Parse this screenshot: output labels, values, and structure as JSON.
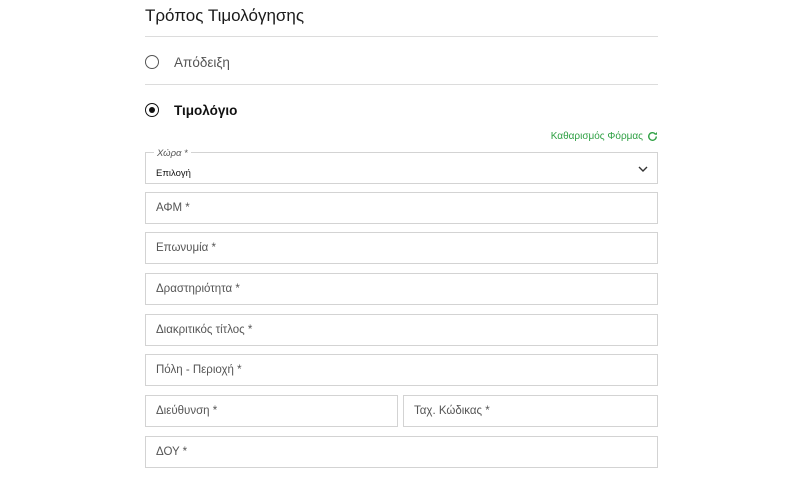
{
  "section": {
    "title": "Τρόπος Τιμολόγησης"
  },
  "billing_options": [
    {
      "label": "Απόδειξη",
      "selected": false
    },
    {
      "label": "Τιμολόγιο",
      "selected": true
    }
  ],
  "form": {
    "reset_label": "Καθαρισμός Φόρμας",
    "country": {
      "label": "Χώρα *",
      "value": "Επιλογή"
    },
    "fields": {
      "afm": "ΑΦΜ *",
      "eponymia": "Επωνυμία *",
      "drastiriotita": "Δραστηριότητα *",
      "diakritikos": "Διακριτικός τίτλος *",
      "poli": "Πόλη - Περιοχή *",
      "dieuthinsi": "Διεύθυνση *",
      "tk": "Ταχ. Κώδικας *",
      "doy": "ΔΟΥ *"
    }
  },
  "colors": {
    "accent": "#2ea043",
    "border": "#d3d3d3"
  },
  "icons": {
    "reset": "refresh-icon",
    "dropdown": "chevron-down-icon"
  }
}
